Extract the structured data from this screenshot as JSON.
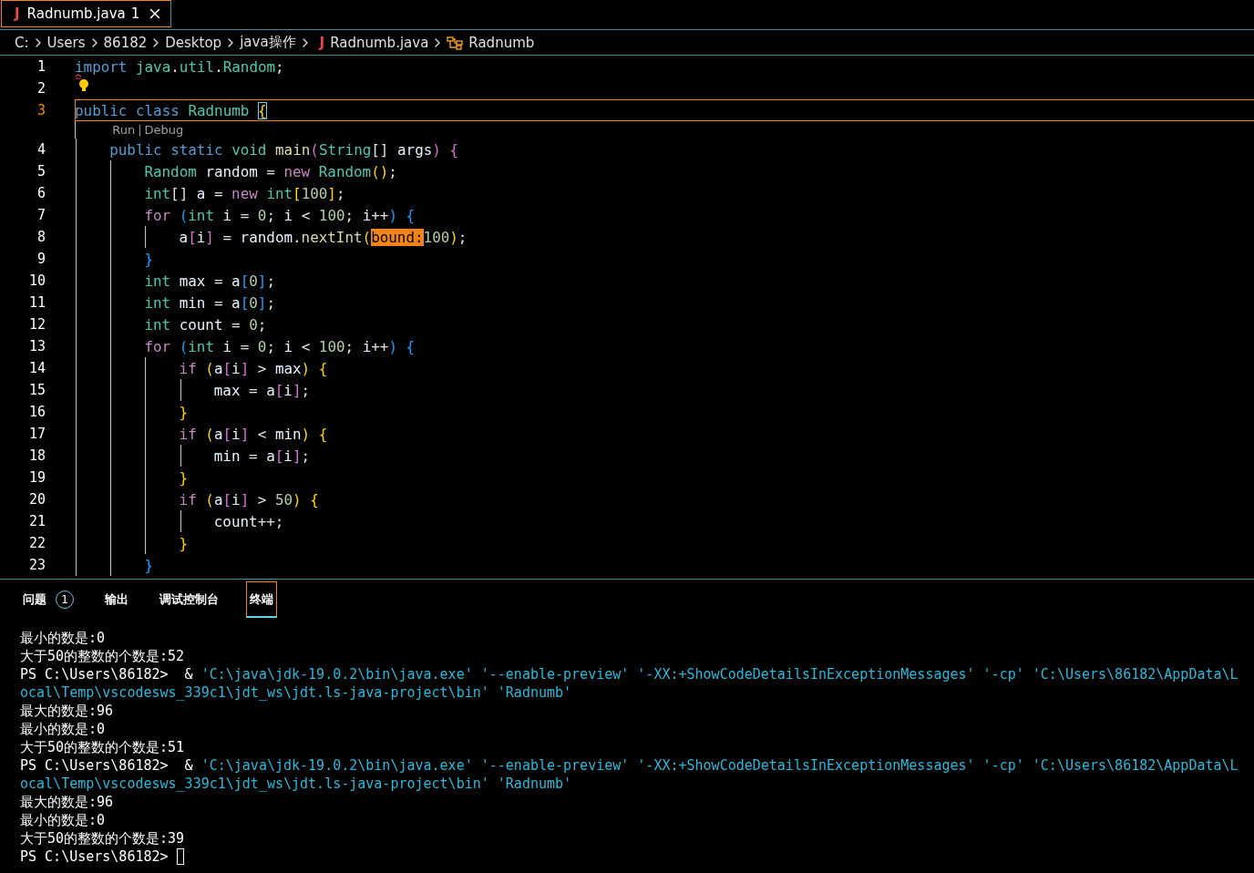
{
  "tab": {
    "icon_glyph": "J",
    "label": "Radnumb.java",
    "badge": "1",
    "selected": true
  },
  "breadcrumb": [
    {
      "kind": "folder",
      "label": "C:"
    },
    {
      "kind": "folder",
      "label": "Users"
    },
    {
      "kind": "folder",
      "label": "86182"
    },
    {
      "kind": "folder",
      "label": "Desktop"
    },
    {
      "kind": "folder",
      "label": "java操作"
    },
    {
      "kind": "file",
      "icon_glyph": "J",
      "label": "Radnumb.java"
    },
    {
      "kind": "class",
      "label": "Radnumb"
    }
  ],
  "editor": {
    "lines": [
      {
        "kind": "code",
        "number": "1",
        "current": false,
        "tokens": [
          {
            "kind": "kw",
            "text": "import"
          },
          {
            "kind": "type",
            "text": "java",
            "space_before": true
          },
          {
            "kind": "p",
            "text": "."
          },
          {
            "kind": "type",
            "text": "util"
          },
          {
            "kind": "p",
            "text": "."
          },
          {
            "kind": "type",
            "text": "Random"
          },
          {
            "kind": "p",
            "text": ";"
          }
        ]
      },
      {
        "kind": "code",
        "number": "2",
        "current": false,
        "lightbulb": true
      },
      {
        "kind": "code",
        "number": "3",
        "current": true,
        "tokens": [
          {
            "kind": "kw",
            "text": "public"
          },
          {
            "kind": "kw",
            "text": "class",
            "space_before": true
          },
          {
            "kind": "type",
            "text": "Radnumb",
            "space_before": true
          },
          {
            "kind": "b1",
            "text": "{",
            "space_before": true,
            "matched": true
          }
        ],
        "children": [
          {
            "kind": "codelens",
            "links": [
              "Run",
              "Debug"
            ],
            "separator": "|"
          },
          {
            "kind": "code",
            "number": "4",
            "current": false,
            "tokens": [
              {
                "kind": "kw",
                "text": "public"
              },
              {
                "kind": "kw",
                "text": "static",
                "space_before": true
              },
              {
                "kind": "type",
                "text": "void",
                "space_before": true
              },
              {
                "kind": "fn",
                "text": "main",
                "space_before": true
              },
              {
                "kind": "b2",
                "text": "("
              },
              {
                "kind": "type",
                "text": "String"
              },
              {
                "kind": "p",
                "text": "[]"
              },
              {
                "kind": "var",
                "text": "args",
                "space_before": true
              },
              {
                "kind": "b2",
                "text": ")"
              },
              {
                "kind": "b2",
                "text": "{",
                "space_before": true
              }
            ],
            "children": [
              {
                "kind": "code",
                "number": "5",
                "current": false,
                "tokens": [
                  {
                    "kind": "type",
                    "text": "Random"
                  },
                  {
                    "kind": "var",
                    "text": "random",
                    "space_before": true
                  },
                  {
                    "kind": "p",
                    "text": " = "
                  },
                  {
                    "kind": "ctrl",
                    "text": "new"
                  },
                  {
                    "kind": "type",
                    "text": "Random",
                    "space_before": true
                  },
                  {
                    "kind": "b1",
                    "text": "()"
                  },
                  {
                    "kind": "p",
                    "text": ";"
                  }
                ]
              },
              {
                "kind": "code",
                "number": "6",
                "current": false,
                "tokens": [
                  {
                    "kind": "type",
                    "text": "int"
                  },
                  {
                    "kind": "p",
                    "text": "[]"
                  },
                  {
                    "kind": "var",
                    "text": "a",
                    "space_before": true
                  },
                  {
                    "kind": "p",
                    "text": " = "
                  },
                  {
                    "kind": "ctrl",
                    "text": "new"
                  },
                  {
                    "kind": "type",
                    "text": "int",
                    "space_before": true
                  },
                  {
                    "kind": "b1",
                    "text": "["
                  },
                  {
                    "kind": "num",
                    "text": "100"
                  },
                  {
                    "kind": "b1",
                    "text": "]"
                  },
                  {
                    "kind": "p",
                    "text": ";"
                  }
                ]
              },
              {
                "kind": "code",
                "number": "7",
                "current": false,
                "tokens": [
                  {
                    "kind": "ctrl",
                    "text": "for"
                  },
                  {
                    "kind": "b3",
                    "text": "(",
                    "space_before": true
                  },
                  {
                    "kind": "type",
                    "text": "int"
                  },
                  {
                    "kind": "var",
                    "text": "i",
                    "space_before": true
                  },
                  {
                    "kind": "p",
                    "text": " = "
                  },
                  {
                    "kind": "num",
                    "text": "0"
                  },
                  {
                    "kind": "p",
                    "text": ";"
                  },
                  {
                    "kind": "var",
                    "text": "i",
                    "space_before": true
                  },
                  {
                    "kind": "p",
                    "text": " < "
                  },
                  {
                    "kind": "num",
                    "text": "100"
                  },
                  {
                    "kind": "p",
                    "text": ";"
                  },
                  {
                    "kind": "var",
                    "text": "i",
                    "space_before": true
                  },
                  {
                    "kind": "p",
                    "text": "++"
                  },
                  {
                    "kind": "b3",
                    "text": ")"
                  },
                  {
                    "kind": "b3",
                    "text": "{",
                    "space_before": true
                  }
                ],
                "children": [
                  {
                    "kind": "code",
                    "number": "8",
                    "current": false,
                    "tokens": [
                      {
                        "kind": "var",
                        "text": "a"
                      },
                      {
                        "kind": "b2",
                        "text": "["
                      },
                      {
                        "kind": "var",
                        "text": "i"
                      },
                      {
                        "kind": "b2",
                        "text": "]"
                      },
                      {
                        "kind": "p",
                        "text": " = "
                      },
                      {
                        "kind": "var",
                        "text": "random"
                      },
                      {
                        "kind": "p",
                        "text": "."
                      },
                      {
                        "kind": "fn",
                        "text": "nextInt"
                      },
                      {
                        "kind": "b1",
                        "text": "("
                      },
                      {
                        "kind": "hint",
                        "text": "bound:"
                      },
                      {
                        "kind": "num",
                        "text": "100"
                      },
                      {
                        "kind": "b1",
                        "text": ")"
                      },
                      {
                        "kind": "p",
                        "text": ";"
                      }
                    ]
                  }
                ]
              },
              {
                "kind": "code",
                "number": "9",
                "current": false,
                "tokens": [
                  {
                    "kind": "b3",
                    "text": "}"
                  }
                ]
              },
              {
                "kind": "code",
                "number": "10",
                "current": false,
                "tokens": [
                  {
                    "kind": "type",
                    "text": "int"
                  },
                  {
                    "kind": "var",
                    "text": "max",
                    "space_before": true
                  },
                  {
                    "kind": "p",
                    "text": " = "
                  },
                  {
                    "kind": "var",
                    "text": "a"
                  },
                  {
                    "kind": "b3",
                    "text": "["
                  },
                  {
                    "kind": "num",
                    "text": "0"
                  },
                  {
                    "kind": "b3",
                    "text": "]"
                  },
                  {
                    "kind": "p",
                    "text": ";"
                  }
                ]
              },
              {
                "kind": "code",
                "number": "11",
                "current": false,
                "tokens": [
                  {
                    "kind": "type",
                    "text": "int"
                  },
                  {
                    "kind": "var",
                    "text": "min",
                    "space_before": true
                  },
                  {
                    "kind": "p",
                    "text": " = "
                  },
                  {
                    "kind": "var",
                    "text": "a"
                  },
                  {
                    "kind": "b3",
                    "text": "["
                  },
                  {
                    "kind": "num",
                    "text": "0"
                  },
                  {
                    "kind": "b3",
                    "text": "]"
                  },
                  {
                    "kind": "p",
                    "text": ";"
                  }
                ]
              },
              {
                "kind": "code",
                "number": "12",
                "current": false,
                "tokens": [
                  {
                    "kind": "type",
                    "text": "int"
                  },
                  {
                    "kind": "var",
                    "text": "count",
                    "space_before": true
                  },
                  {
                    "kind": "p",
                    "text": " = "
                  },
                  {
                    "kind": "num",
                    "text": "0"
                  },
                  {
                    "kind": "p",
                    "text": ";"
                  }
                ]
              },
              {
                "kind": "code",
                "number": "13",
                "current": false,
                "tokens": [
                  {
                    "kind": "ctrl",
                    "text": "for"
                  },
                  {
                    "kind": "b3",
                    "text": "(",
                    "space_before": true
                  },
                  {
                    "kind": "type",
                    "text": "int"
                  },
                  {
                    "kind": "var",
                    "text": "i",
                    "space_before": true
                  },
                  {
                    "kind": "p",
                    "text": " = "
                  },
                  {
                    "kind": "num",
                    "text": "0"
                  },
                  {
                    "kind": "p",
                    "text": ";"
                  },
                  {
                    "kind": "var",
                    "text": "i",
                    "space_before": true
                  },
                  {
                    "kind": "p",
                    "text": " < "
                  },
                  {
                    "kind": "num",
                    "text": "100"
                  },
                  {
                    "kind": "p",
                    "text": ";"
                  },
                  {
                    "kind": "var",
                    "text": "i",
                    "space_before": true
                  },
                  {
                    "kind": "p",
                    "text": "++"
                  },
                  {
                    "kind": "b3",
                    "text": ")"
                  },
                  {
                    "kind": "b3",
                    "text": "{",
                    "space_before": true
                  }
                ],
                "children": [
                  {
                    "kind": "code",
                    "number": "14",
                    "current": false,
                    "tokens": [
                      {
                        "kind": "ctrl",
                        "text": "if"
                      },
                      {
                        "kind": "b1",
                        "text": "(",
                        "space_before": true
                      },
                      {
                        "kind": "var",
                        "text": "a"
                      },
                      {
                        "kind": "b2",
                        "text": "["
                      },
                      {
                        "kind": "var",
                        "text": "i"
                      },
                      {
                        "kind": "b2",
                        "text": "]"
                      },
                      {
                        "kind": "p",
                        "text": " > "
                      },
                      {
                        "kind": "var",
                        "text": "max"
                      },
                      {
                        "kind": "b1",
                        "text": ")"
                      },
                      {
                        "kind": "b1",
                        "text": "{",
                        "space_before": true
                      }
                    ],
                    "children": [
                      {
                        "kind": "code",
                        "number": "15",
                        "current": false,
                        "tokens": [
                          {
                            "kind": "var",
                            "text": "max"
                          },
                          {
                            "kind": "p",
                            "text": " = "
                          },
                          {
                            "kind": "var",
                            "text": "a"
                          },
                          {
                            "kind": "b2",
                            "text": "["
                          },
                          {
                            "kind": "var",
                            "text": "i"
                          },
                          {
                            "kind": "b2",
                            "text": "]"
                          },
                          {
                            "kind": "p",
                            "text": ";"
                          }
                        ]
                      }
                    ]
                  },
                  {
                    "kind": "code",
                    "number": "16",
                    "current": false,
                    "tokens": [
                      {
                        "kind": "b1",
                        "text": "}"
                      }
                    ]
                  },
                  {
                    "kind": "code",
                    "number": "17",
                    "current": false,
                    "tokens": [
                      {
                        "kind": "ctrl",
                        "text": "if"
                      },
                      {
                        "kind": "b1",
                        "text": "(",
                        "space_before": true
                      },
                      {
                        "kind": "var",
                        "text": "a"
                      },
                      {
                        "kind": "b2",
                        "text": "["
                      },
                      {
                        "kind": "var",
                        "text": "i"
                      },
                      {
                        "kind": "b2",
                        "text": "]"
                      },
                      {
                        "kind": "p",
                        "text": " < "
                      },
                      {
                        "kind": "var",
                        "text": "min"
                      },
                      {
                        "kind": "b1",
                        "text": ")"
                      },
                      {
                        "kind": "b1",
                        "text": "{",
                        "space_before": true
                      }
                    ],
                    "children": [
                      {
                        "kind": "code",
                        "number": "18",
                        "current": false,
                        "tokens": [
                          {
                            "kind": "var",
                            "text": "min"
                          },
                          {
                            "kind": "p",
                            "text": " = "
                          },
                          {
                            "kind": "var",
                            "text": "a"
                          },
                          {
                            "kind": "b2",
                            "text": "["
                          },
                          {
                            "kind": "var",
                            "text": "i"
                          },
                          {
                            "kind": "b2",
                            "text": "]"
                          },
                          {
                            "kind": "p",
                            "text": ";"
                          }
                        ]
                      }
                    ]
                  },
                  {
                    "kind": "code",
                    "number": "19",
                    "current": false,
                    "tokens": [
                      {
                        "kind": "b1",
                        "text": "}"
                      }
                    ]
                  },
                  {
                    "kind": "code",
                    "number": "20",
                    "current": false,
                    "tokens": [
                      {
                        "kind": "ctrl",
                        "text": "if"
                      },
                      {
                        "kind": "b1",
                        "text": "(",
                        "space_before": true
                      },
                      {
                        "kind": "var",
                        "text": "a"
                      },
                      {
                        "kind": "b2",
                        "text": "["
                      },
                      {
                        "kind": "var",
                        "text": "i"
                      },
                      {
                        "kind": "b2",
                        "text": "]"
                      },
                      {
                        "kind": "p",
                        "text": " > "
                      },
                      {
                        "kind": "num",
                        "text": "50"
                      },
                      {
                        "kind": "b1",
                        "text": ")"
                      },
                      {
                        "kind": "b1",
                        "text": "{",
                        "space_before": true
                      }
                    ],
                    "children": [
                      {
                        "kind": "code",
                        "number": "21",
                        "current": false,
                        "tokens": [
                          {
                            "kind": "var",
                            "text": "count"
                          },
                          {
                            "kind": "p",
                            "text": "++;"
                          }
                        ]
                      }
                    ]
                  },
                  {
                    "kind": "code",
                    "number": "22",
                    "current": false,
                    "tokens": [
                      {
                        "kind": "b1",
                        "text": "}"
                      }
                    ]
                  }
                ]
              },
              {
                "kind": "code",
                "number": "23",
                "current": false,
                "tokens": [
                  {
                    "kind": "b3",
                    "text": "}"
                  }
                ]
              }
            ]
          }
        ]
      }
    ]
  },
  "panel": {
    "tabs": [
      {
        "label": "问题",
        "badge": "1",
        "selected": false
      },
      {
        "label": "输出",
        "selected": false
      },
      {
        "label": "调试控制台",
        "selected": false
      },
      {
        "label": "终端",
        "selected": true
      }
    ],
    "terminal": [
      {
        "segments": [
          {
            "kind": "out",
            "text": "最小的数是:0"
          }
        ]
      },
      {
        "segments": [
          {
            "kind": "out",
            "text": "大于50的整数的个数是:52"
          }
        ]
      },
      {
        "segments": [
          {
            "kind": "out",
            "text": "PS C:\\Users\\86182>  & "
          },
          {
            "kind": "arg",
            "text": "'C:\\java\\jdk-19.0.2\\bin\\java.exe' '--enable-preview' '-XX:+ShowCodeDetailsInExceptionMessages' '-cp' 'C:\\Users\\86182\\AppData\\L"
          }
        ]
      },
      {
        "segments": [
          {
            "kind": "arg",
            "text": "ocal\\Temp\\vscodesws_339c1\\jdt_ws\\jdt.ls-java-project\\bin' 'Radnumb'"
          }
        ]
      },
      {
        "segments": [
          {
            "kind": "out",
            "text": "最大的数是:96"
          }
        ]
      },
      {
        "segments": [
          {
            "kind": "out",
            "text": "最小的数是:0"
          }
        ]
      },
      {
        "segments": [
          {
            "kind": "out",
            "text": "大于50的整数的个数是:51"
          }
        ]
      },
      {
        "segments": [
          {
            "kind": "out",
            "text": "PS C:\\Users\\86182>  & "
          },
          {
            "kind": "arg",
            "text": "'C:\\java\\jdk-19.0.2\\bin\\java.exe' '--enable-preview' '-XX:+ShowCodeDetailsInExceptionMessages' '-cp' 'C:\\Users\\86182\\AppData\\L"
          }
        ]
      },
      {
        "segments": [
          {
            "kind": "arg",
            "text": "ocal\\Temp\\vscodesws_339c1\\jdt_ws\\jdt.ls-java-project\\bin' 'Radnumb'"
          }
        ]
      },
      {
        "segments": [
          {
            "kind": "out",
            "text": "最大的数是:96"
          }
        ]
      },
      {
        "segments": [
          {
            "kind": "out",
            "text": "最小的数是:0"
          }
        ]
      },
      {
        "segments": [
          {
            "kind": "out",
            "text": "大于50的整数的个数是:39"
          }
        ]
      },
      {
        "segments": [
          {
            "kind": "out",
            "text": "PS C:\\Users\\86182>"
          }
        ],
        "cursor": true
      }
    ]
  }
}
